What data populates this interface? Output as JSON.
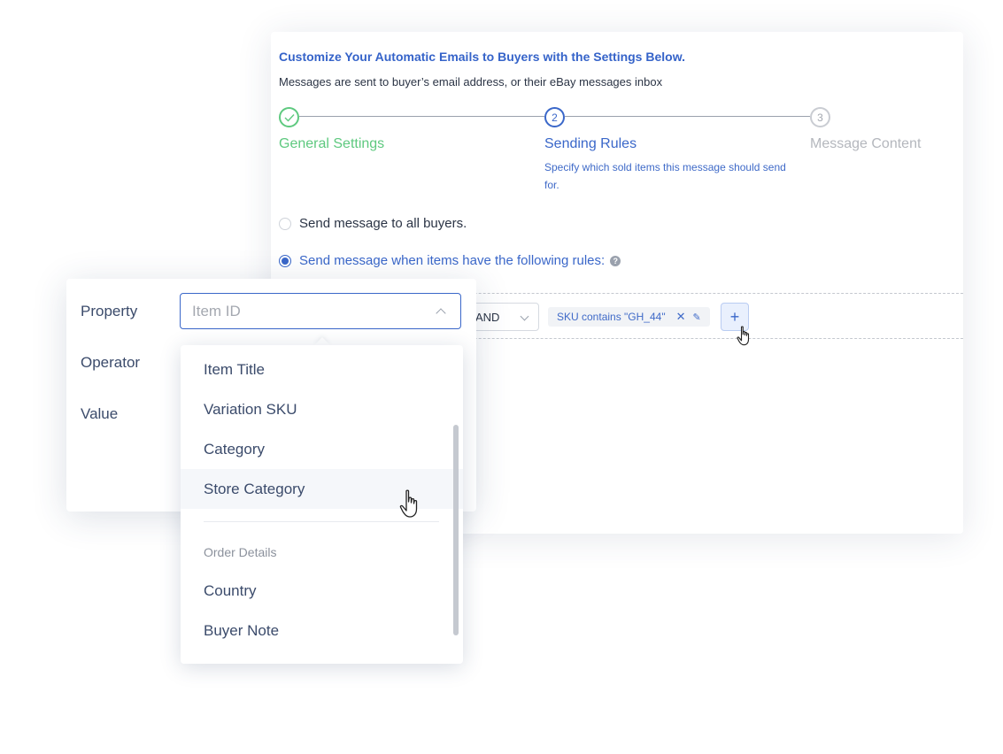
{
  "header": {
    "title": "Customize Your Automatic Emails to Buyers with the Settings Below.",
    "subtitle": "Messages are sent to buyer’s email address, or their eBay messages inbox"
  },
  "stepper": {
    "steps": [
      {
        "number": "1",
        "label": "General Settings",
        "status": "completed"
      },
      {
        "number": "2",
        "label": "Sending Rules",
        "status": "active",
        "description": "Specify which sold items this message should send for."
      },
      {
        "number": "3",
        "label": "Message Content",
        "status": "upcoming"
      }
    ]
  },
  "send_options": {
    "all_buyers_label": "Send message to all buyers.",
    "rules_label": "Send message when items have the following rules:",
    "selected": "rules"
  },
  "rules": {
    "conjunction": "AND",
    "chips": [
      {
        "text": "SKU contains \"GH_44\""
      }
    ]
  },
  "filter_panel": {
    "property_label": "Property",
    "operator_label": "Operator",
    "value_label": "Value",
    "property_placeholder": "Item ID"
  },
  "dropdown": {
    "items": [
      "Item Title",
      "Variation SKU",
      "Category",
      "Store Category"
    ],
    "hovered_item": "Store Category",
    "group_label": "Order Details",
    "group_items": [
      "Country",
      "Buyer Note"
    ]
  },
  "colors": {
    "accent": "#3a67c9",
    "success": "#5ec97f",
    "muted": "#b4b7bd"
  }
}
